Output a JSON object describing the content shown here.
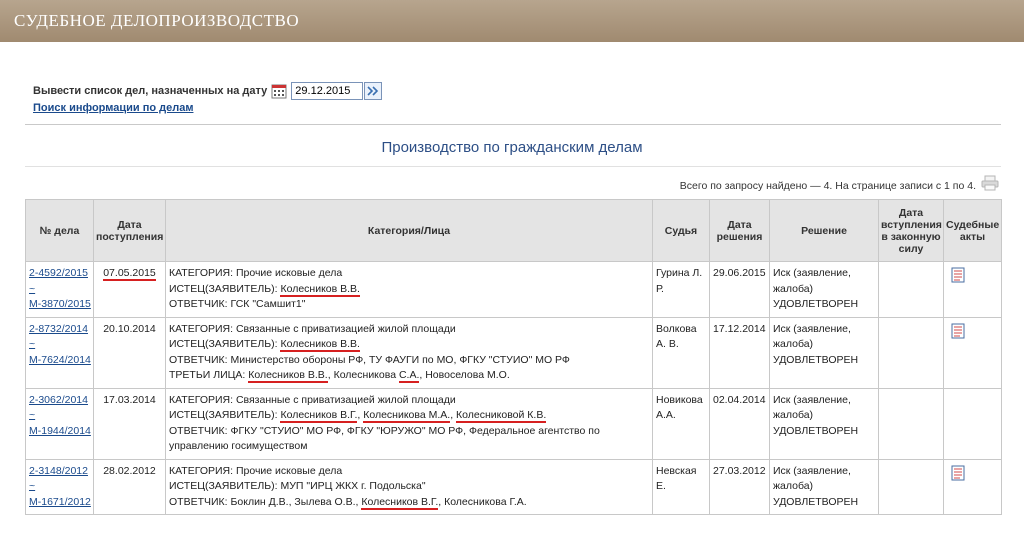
{
  "header": {
    "title": "СУДЕБНОЕ ДЕЛОПРОИЗВОДСТВО"
  },
  "date_filter": {
    "label": "Вывести список дел, назначенных на дату",
    "value": "29.12.2015",
    "calendar_icon": "calendar-icon",
    "go_icon": "double-chevron-right-icon"
  },
  "search_link": "Поиск информации по делам",
  "page_title": "Производство по гражданским делам",
  "found_text": "Всего по запросу найдено — 4. На странице записи с 1 по 4.",
  "print_icon": "printer-icon",
  "table": {
    "columns": {
      "num": "№ дела",
      "received": "Дата поступления",
      "category": "Категория/Лица",
      "judge": "Судья",
      "decision_date": "Дата решения",
      "decision": "Решение",
      "effective": "Дата вступления в законную силу",
      "acts": "Судебные акты"
    },
    "rows": [
      {
        "num1": "2-4592/2015",
        "sep": "~",
        "num2": "М-3870/2015",
        "received": "07.05.2015",
        "category": "КАТЕГОРИЯ: Прочие исковые дела",
        "plaintiff_label": "ИСТЕЦ(ЗАЯВИТЕЛЬ): ",
        "plaintiff": "Колесников В.В.",
        "defendant": "ОТВЕТЧИК: ГСК \"Самшит1\"",
        "judge": "Гурина Л. Р.",
        "decision_date": "29.06.2015",
        "decision_kind": "Иск (заявление, жалоба)",
        "decision": "УДОВЛЕТВОРЕН",
        "act_icon": "document-icon"
      },
      {
        "num1": "2-8732/2014",
        "sep": "~",
        "num2": "М-7624/2014",
        "received": "20.10.2014",
        "category": "КАТЕГОРИЯ: Связанные с приватизацией жилой площади",
        "plaintiff_label": "ИСТЕЦ(ЗАЯВИТЕЛЬ): ",
        "plaintiff": "Колесников В.В.",
        "defendant": "ОТВЕТЧИК: Министерство обороны РФ, ТУ ФАУГИ по МО, ФГКУ \"СТУИО\" МО РФ",
        "third_label": "ТРЕТЬИ ЛИЦА: ",
        "third_1": "Колесников В.В.",
        "third_2a": "Колесникова ",
        "third_2b": "С.А.",
        "third_3": "Новоселова М.О.",
        "judge": "Волкова А. В.",
        "decision_date": "17.12.2014",
        "decision_kind": "Иск (заявление, жалоба)",
        "decision": "УДОВЛЕТВОРЕН",
        "act_icon": "document-icon"
      },
      {
        "num1": "2-3062/2014",
        "sep": "~",
        "num2": "М-1944/2014",
        "received": "17.03.2014",
        "category": "КАТЕГОРИЯ: Связанные с приватизацией жилой площади",
        "plaintiff_label": "ИСТЕЦ(ЗАЯВИТЕЛЬ): ",
        "plaintiff_1": "Колесников В.Г.",
        "plaintiff_2": "Колесникова М.А.",
        "plaintiff_3": "Колесниковой К.В.",
        "defendant": "ОТВЕТЧИК: ФГКУ \"СТУИО\" МО РФ, ФГКУ \"ЮРУЖО\" МО РФ, Федеральное агентство по управлению госимуществом",
        "judge": "Новикова А.А.",
        "decision_date": "02.04.2014",
        "decision_kind": "Иск (заявление, жалоба)",
        "decision": "УДОВЛЕТВОРЕН",
        "act_icon": "document-icon"
      },
      {
        "num1": "2-3148/2012",
        "sep": "~",
        "num2": "М-1671/2012",
        "received": "28.02.2012",
        "category": "КАТЕГОРИЯ: Прочие исковые дела",
        "plaintiff_text": "ИСТЕЦ(ЗАЯВИТЕЛЬ): МУП \"ИРЦ ЖКХ г. Подольска\"",
        "defendant_label": "ОТВЕТЧИК: Боклин Д.В., Зылева О.В., ",
        "defendant_hl": "Колесников В.Г.",
        "defendant_rest": ", Колесникова Г.А.",
        "judge": "Невская Е.",
        "decision_date": "27.03.2012",
        "decision_kind": "Иск (заявление, жалоба)",
        "decision": "УДОВЛЕТВОРЕН",
        "act_icon": "document-icon"
      }
    ]
  }
}
